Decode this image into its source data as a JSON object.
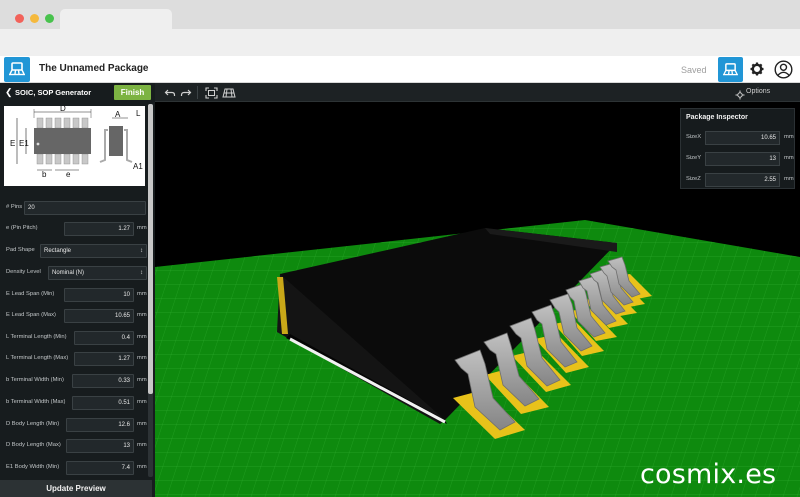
{
  "app": {
    "title": "The Unnamed Package",
    "status": "Saved"
  },
  "header_icons": [
    "package-icon",
    "gear-icon",
    "user-icon"
  ],
  "panel": {
    "title": "SOIC, SOP Generator",
    "finish_label": "Finish",
    "update_label": "Update Preview",
    "diagram_labels": {
      "d": "D",
      "e": "E",
      "e1": "E1",
      "b": "b",
      "pitch": "e",
      "a": "A",
      "l": "L",
      "a1": "A1"
    },
    "fields": [
      {
        "label": "# Pins",
        "value": "20",
        "unit": ""
      },
      {
        "label": "e (Pin Pitch)",
        "value": "1.27",
        "unit": "mm"
      },
      {
        "label": "Pad Shape",
        "value": "Rectangle",
        "unit": ""
      },
      {
        "label": "Density Level",
        "value": "Nominal (N)",
        "unit": ""
      },
      {
        "label": "E Lead Span (Min)",
        "value": "10",
        "unit": "mm"
      },
      {
        "label": "E Lead Span (Max)",
        "value": "10.65",
        "unit": "mm"
      },
      {
        "label": "L Terminal Length (Min)",
        "value": "0.4",
        "unit": "mm"
      },
      {
        "label": "L Terminal Length (Max)",
        "value": "1.27",
        "unit": "mm"
      },
      {
        "label": "b Terminal Width (Min)",
        "value": "0.33",
        "unit": "mm"
      },
      {
        "label": "b Terminal Width (Max)",
        "value": "0.51",
        "unit": "mm"
      },
      {
        "label": "D Body Length (Min)",
        "value": "12.6",
        "unit": "mm"
      },
      {
        "label": "D Body Length (Max)",
        "value": "13",
        "unit": "mm"
      },
      {
        "label": "E1 Body Width (Min)",
        "value": "7.4",
        "unit": "mm"
      }
    ]
  },
  "toolbar": {
    "options_label": "Options"
  },
  "inspector": {
    "title": "Package Inspector",
    "rows": [
      {
        "label": "SizeX",
        "value": "10.65",
        "unit": "mm"
      },
      {
        "label": "SizeY",
        "value": "13",
        "unit": "mm"
      },
      {
        "label": "SizeZ",
        "value": "2.55",
        "unit": "mm"
      }
    ]
  },
  "watermark": "cosmix.es",
  "colors": {
    "accent": "#2196d6",
    "finish": "#7cb342",
    "board": "#0e8a0e",
    "pad": "#e8c21a",
    "lead": "#9a9a9a"
  }
}
